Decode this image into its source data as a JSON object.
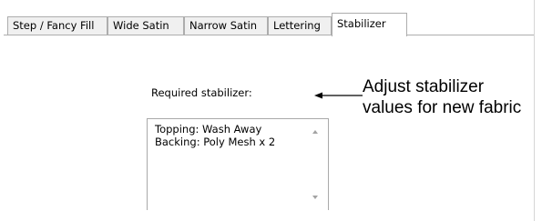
{
  "tabs": [
    {
      "label": "Step / Fancy Fill",
      "active": false
    },
    {
      "label": "Wide Satin",
      "active": false
    },
    {
      "label": "Narrow Satin",
      "active": false
    },
    {
      "label": "Lettering",
      "active": false
    },
    {
      "label": "Stabilizer",
      "active": true
    }
  ],
  "stabilizer": {
    "label": "Required stabilizer:",
    "memo_text": "Topping: Wash Away\nBacking: Poly Mesh x 2"
  },
  "callout": {
    "line1": "Adjust stabilizer",
    "line2": "values for new fabric"
  },
  "icons": {
    "scroll_up": "scroll-up-arrow-icon",
    "scroll_down": "scroll-down-arrow-icon",
    "callout_arrow": "left-arrow-icon"
  },
  "colors": {
    "tab_inactive_bg": "#f0f0f0",
    "border": "#adadad",
    "scroll_arrow": "#a3a3a3"
  }
}
